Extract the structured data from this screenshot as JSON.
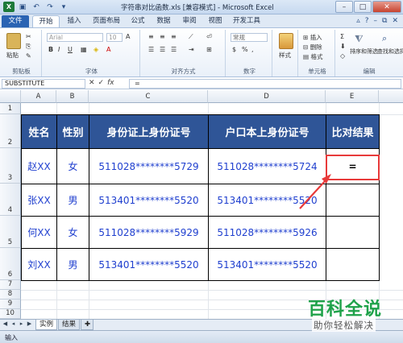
{
  "window": {
    "title": "字符串对比函数.xls [兼容模式] - Microsoft Excel"
  },
  "ribbon": {
    "tabs": [
      "文件",
      "开始",
      "插入",
      "页面布局",
      "公式",
      "数据",
      "审阅",
      "视图",
      "开发工具"
    ],
    "active_tab": "开始",
    "font_name": "Arial",
    "font_size": "10",
    "groups": {
      "clipboard": "剪贴板",
      "font": "字体",
      "alignment": "对齐方式",
      "number": "数字",
      "cells": "单元格",
      "editing": "编辑"
    },
    "paste_label": "粘贴",
    "style_label": "样式",
    "insert_label": "插入",
    "delete_label": "删除",
    "format_label": "格式",
    "sort_filter_label": "排序和筛选",
    "find_select_label": "查找和选择",
    "number_format": "常规"
  },
  "formula_bar": {
    "name_box": "SUBSTITUTE",
    "cancel_glyph": "✕",
    "enter_glyph": "✓",
    "fx_label": "fx",
    "formula": "="
  },
  "sheet": {
    "columns": [
      "A",
      "B",
      "C",
      "D",
      "E"
    ],
    "rows": [
      "1",
      "2",
      "3",
      "4",
      "5",
      "6",
      "7",
      "8",
      "9",
      "10",
      "11",
      "12"
    ],
    "table": {
      "headers": [
        "姓名",
        "性别",
        "身份证上身份证号",
        "户口本上身份证号",
        "比对结果"
      ],
      "rows": [
        [
          "赵XX",
          "女",
          "511028********5729",
          "511028********5724",
          "="
        ],
        [
          "张XX",
          "男",
          "513401********5520",
          "513401********5520",
          ""
        ],
        [
          "何XX",
          "女",
          "511028********5929",
          "511028********5926",
          ""
        ],
        [
          "刘XX",
          "男",
          "513401********5520",
          "513401********5520",
          ""
        ]
      ]
    }
  },
  "sheet_tabs": [
    "实例",
    "结果"
  ],
  "active_sheet": "实例",
  "status": {
    "mode": "输入"
  },
  "watermark": {
    "title": "百科全说",
    "subtitle": "助你轻松解决"
  },
  "colors": {
    "header_fill": "#2f5597",
    "data_text": "#1f3fcf",
    "highlight": "#e83a3a",
    "watermark": "#1fa24a"
  }
}
